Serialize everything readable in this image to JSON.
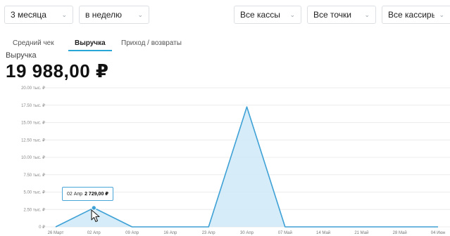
{
  "filters": {
    "period": "3 месяца",
    "grouping": "в неделю",
    "cash_registers": "Все кассы",
    "points": "Все точки",
    "cashiers": "Все кассиры"
  },
  "tabs": [
    "Средний чек",
    "Выручка",
    "Приход / возвраты"
  ],
  "active_tab": "Выручка",
  "metric": {
    "label": "Выручка",
    "value": "19 988,00 ₽"
  },
  "tooltip": {
    "date": "02 Апр",
    "value": "2 729,00 ₽"
  },
  "colors": {
    "accent": "#2aa6d6",
    "area_fill": "#cfe9f7",
    "line": "#3ea1d6"
  },
  "chart_data": {
    "type": "area",
    "x": [
      "26 Март",
      "02 Апр",
      "09 Апр",
      "16 Апр",
      "23 Апр",
      "30 Апр",
      "07 Май",
      "14 Май",
      "21 Май",
      "28 Май",
      "04 Июн"
    ],
    "values": [
      0,
      2729,
      0,
      0,
      0,
      17259,
      0,
      0,
      0,
      0,
      0
    ],
    "y_ticks": [
      "0 ₽",
      "2.50 тыс. ₽",
      "5.00 тыс. ₽",
      "7.50 тыс. ₽",
      "10.00 тыс. ₽",
      "12.50 тыс. ₽",
      "15.00 тыс. ₽",
      "17.50 тыс. ₽",
      "20.00 тыс. ₽"
    ],
    "ylim": [
      0,
      20000
    ],
    "grid": true
  }
}
